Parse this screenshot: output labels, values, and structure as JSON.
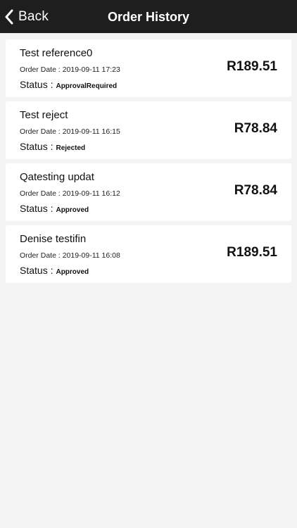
{
  "header": {
    "back_label": "Back",
    "title": "Order History",
    "back_icon": "chevron-left-icon"
  },
  "orders": [
    {
      "name": "Test reference0",
      "date": "Order Date : 2019-09-11 17:23",
      "status_label": "Status :",
      "status": "ApprovalRequired",
      "amount": "R189.51"
    },
    {
      "name": "Test reject",
      "date": "Order Date : 2019-09-11 16:15",
      "status_label": "Status :",
      "status": "Rejected",
      "amount": "R78.84"
    },
    {
      "name": "Qatesting updat",
      "date": "Order Date : 2019-09-11 16:12",
      "status_label": "Status :",
      "status": "Approved",
      "amount": "R78.84"
    },
    {
      "name": "Denise testifin",
      "date": "Order Date : 2019-09-11 16:08",
      "status_label": "Status :",
      "status": "Approved",
      "amount": "R189.51"
    }
  ],
  "colors": {
    "nav_background": "#1e1e1e",
    "page_background": "#f4f4f4",
    "card_background": "#ffffff"
  }
}
